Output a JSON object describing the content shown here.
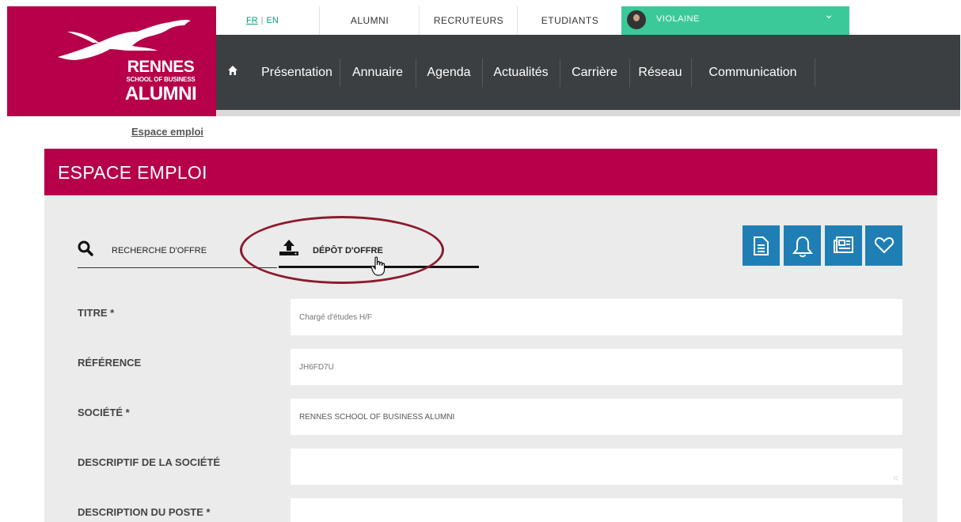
{
  "logo": {
    "line1": "RENNES",
    "line2": "SCHOOL OF BUSINESS",
    "line3": "ALUMNI"
  },
  "topbar": {
    "lang_fr": "FR",
    "lang_sep": "|",
    "lang_en": "EN",
    "links": [
      "ALUMNI",
      "RECRUTEURS",
      "ETUDIANTS"
    ],
    "user_name": "VIOLAINE"
  },
  "nav": {
    "items": [
      "Présentation",
      "Annuaire",
      "Agenda",
      "Actualités",
      "Carrière",
      "Réseau",
      "Communication"
    ]
  },
  "breadcrumb": "Espace emploi",
  "section_title": "ESPACE EMPLOI",
  "tabs": {
    "search": "RECHERCHE D'OFFRE",
    "deposit": "DÉPÔT D'OFFRE"
  },
  "tool_icons": [
    "document-icon",
    "bell-icon",
    "newspaper-icon",
    "heart-icon"
  ],
  "form": {
    "title_label": "TITRE *",
    "title_placeholder": "Chargé d'études H/F",
    "reference_label": "RÉFÉRENCE",
    "reference_placeholder": "JH6FD7U",
    "company_label": "SOCIÉTÉ *",
    "company_value": "RENNES SCHOOL OF BUSINESS ALUMNI",
    "company_desc_label": "DESCRIPTIF DE LA SOCIÉTÉ",
    "job_desc_label": "DESCRIPTION DU POSTE *"
  },
  "colors": {
    "brand": "#b7004a",
    "nav_bg": "#3b3f42",
    "accent_green": "#3cc99a",
    "icon_blue": "#1f7fb5",
    "highlight_ellipse": "#8d1a2d"
  }
}
